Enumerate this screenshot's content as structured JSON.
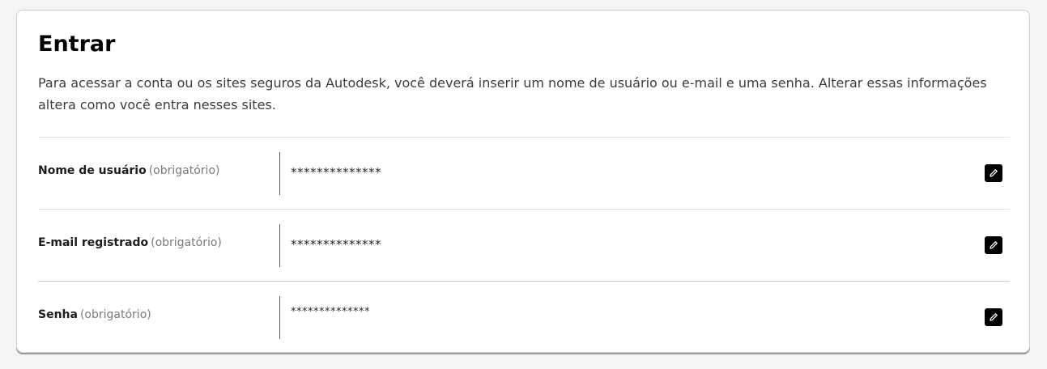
{
  "section": {
    "title": "Entrar",
    "description": "Para acessar a conta ou os sites seguros da Autodesk, você deverá inserir um nome de usuário ou e-mail e uma senha. Alterar essas informações\naltera como você entra nesses sites."
  },
  "fields": [
    {
      "label": "Nome de usuário",
      "required": "(obrigatório)",
      "value": "**************",
      "edit_icon": "pencil-icon"
    },
    {
      "label": "E-mail registrado",
      "required": "(obrigatório)",
      "value": "**************",
      "edit_icon": "pencil-icon"
    },
    {
      "label": "Senha",
      "required": "(obrigatório)",
      "value": "**************",
      "edit_icon": "pencil-icon"
    }
  ],
  "colors": {
    "accent": "#000000",
    "background": "#f4f4f4",
    "card": "#ffffff"
  }
}
